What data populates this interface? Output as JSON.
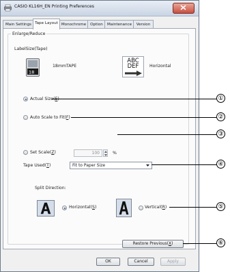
{
  "window": {
    "title": "CASIO KL16H_EN Printing Preferences"
  },
  "tabs": [
    {
      "label": "Main Settings"
    },
    {
      "label": "Tape Layout"
    },
    {
      "label": "Monochrome"
    },
    {
      "label": "Option"
    },
    {
      "label": "Maintenance"
    },
    {
      "label": "Version"
    }
  ],
  "active_tab": "Tape Layout",
  "enlarge": {
    "group_label": "Enlarge/Reduce",
    "label_size_label": "LabelSize(Tape)",
    "tape_icon_text": "18",
    "tape_name": "18mmTAPE",
    "orientation_icon_text": [
      "ABC",
      "DEF"
    ],
    "orientation": "Horizontal",
    "options": [
      {
        "label": "Actual Size",
        "mnemonic": "E",
        "checked": true
      },
      {
        "label": "Auto Scale to Fit",
        "mnemonic": "F",
        "checked": false
      },
      {
        "label": "Set Scale",
        "mnemonic": "Z",
        "checked": false
      }
    ],
    "scale_value": "100",
    "scale_unit": "%"
  },
  "tape_used": {
    "label": "Tape Used",
    "mnemonic": "T",
    "selected": "Fit to Paper Size"
  },
  "split": {
    "label": "Split Direction:",
    "options": [
      {
        "label": "Horizontal",
        "mnemonic": "S",
        "checked": true
      },
      {
        "label": "Vertical",
        "mnemonic": "R",
        "checked": false
      }
    ]
  },
  "buttons": {
    "restore": {
      "label": "Restore Previous",
      "mnemonic": "X"
    },
    "ok": "OK",
    "cancel": "Cancel",
    "apply": "Apply"
  },
  "callouts": [
    "①",
    "②",
    "③",
    "④",
    "⑤",
    "⑥"
  ],
  "colors": {
    "accent": "#2b4f8a",
    "close": "#c8503f"
  }
}
